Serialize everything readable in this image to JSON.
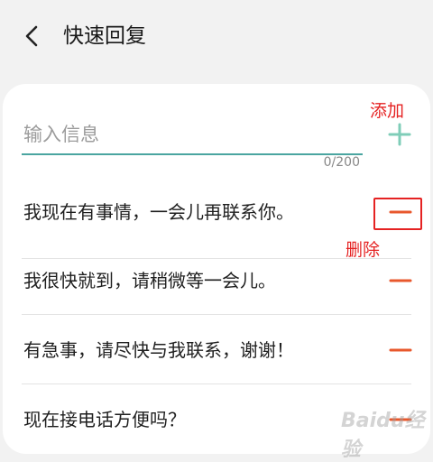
{
  "header": {
    "title": "快速回复",
    "back_icon": "back-arrow-icon"
  },
  "input": {
    "placeholder": "输入信息",
    "value": "",
    "counter": "0/200"
  },
  "add_button": {
    "icon": "plus-icon",
    "color": "#7fcdb8"
  },
  "annotations": {
    "add_label": "添加",
    "delete_label": "删除",
    "color": "#e52222"
  },
  "replies": [
    {
      "text": "我现在有事情，一会儿再联系你。"
    },
    {
      "text": "我很快就到，请稍微等一会儿。"
    },
    {
      "text": "有急事，请尽快与我联系，谢谢！"
    },
    {
      "text": "现在接电话方便吗？"
    }
  ],
  "remove_icon": {
    "icon": "minus-icon",
    "color": "#e8582d"
  },
  "watermark": "Baidu经验"
}
